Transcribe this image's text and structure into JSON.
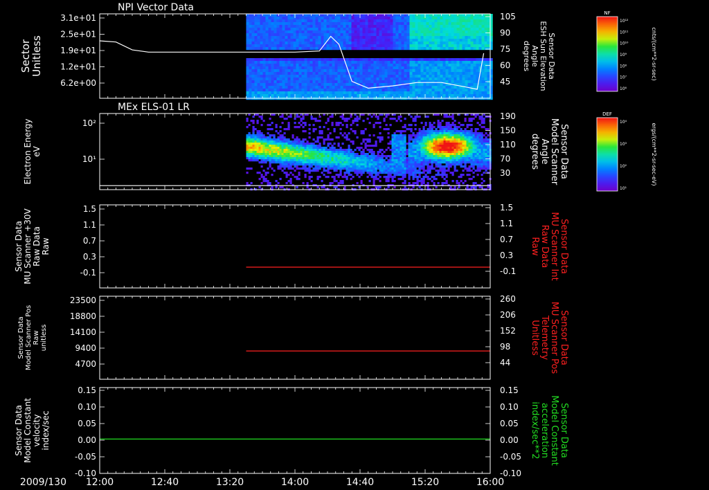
{
  "colors": {
    "axis": "#ffffff",
    "line_red": "#ff2020",
    "line_green": "#22dd22",
    "label_red": "#ff2020",
    "label_green": "#22dd22"
  },
  "colorbars": [
    {
      "label": "NF",
      "ticks": [
        "10¹²",
        "10¹¹",
        "10¹⁰",
        "10⁹",
        "10⁸",
        "10⁷",
        "10⁶"
      ],
      "units": "cnts/(cm**2-sr-sec)"
    },
    {
      "label": "DEF",
      "ticks": [
        "10⁴",
        "10³",
        "10²",
        "10¹"
      ],
      "units": "ergs/(cm**2-sr-sec-eV)"
    }
  ],
  "chart_data": [
    {
      "type": "heatmap",
      "title": "NPI Vector Data",
      "ylabel": [
        "Sector",
        "Unitless"
      ],
      "yticks": [
        "3.1e+01",
        "2.5e+01",
        "1.9e+01",
        "1.2e+01",
        "6.2e+00"
      ],
      "y2label": [
        "Sensor Data",
        "ESH Sun Elevation",
        "Angle",
        "degrees"
      ],
      "y2ticks": [
        "105",
        "90",
        "75",
        "60",
        "45"
      ],
      "y2lim": [
        30,
        105
      ],
      "data_start": "13:30",
      "overlay_series": {
        "name": "ESH Sun Elevation Angle",
        "x": [
          "12:00",
          "12:10",
          "12:20",
          "12:30",
          "13:00",
          "13:30",
          "14:00",
          "14:15",
          "14:22",
          "14:27",
          "14:35",
          "14:45",
          "15:00",
          "15:15",
          "15:30",
          "15:45",
          "15:52",
          "15:56"
        ],
        "y": [
          81,
          80,
          73,
          71,
          71,
          71,
          71,
          72,
          85,
          78,
          45,
          39,
          41,
          44,
          44,
          40,
          38,
          70
        ]
      }
    },
    {
      "type": "heatmap",
      "title": "MEx ELS-01 LR",
      "ylabel": [
        "Electron Energy",
        "eV"
      ],
      "yticks": [
        "10²",
        "10¹"
      ],
      "y2label": [
        "Sensor Data",
        "Model Scanner",
        "Angle",
        "degrees"
      ],
      "y2ticks": [
        "190",
        "150",
        "110",
        "70",
        "30"
      ],
      "y2lim": [
        0,
        190
      ],
      "data_start": "13:30",
      "overlay_series": {
        "name": "Model Scanner Angle",
        "x": [
          "12:00",
          "16:00"
        ],
        "y": [
          10,
          10
        ]
      }
    },
    {
      "type": "line",
      "ylabel": [
        "Sensor Data",
        "MU Scanner +30V",
        "Raw Data",
        "Raw"
      ],
      "yticks": [
        "1.5",
        "1.1",
        "0.7",
        "0.3",
        "-0.1"
      ],
      "ylim": [
        -0.5,
        1.5
      ],
      "y2label": [
        "Sensor Data",
        "MU Scanner Int",
        "Raw Data",
        "Raw"
      ],
      "y2ticks": [
        "1.5",
        "1.1",
        "0.7",
        "0.3",
        "-0.1"
      ],
      "series": [
        {
          "x": [
            "13:30",
            "16:00"
          ],
          "y": [
            0.0,
            0.0
          ],
          "color": "#ff2020"
        }
      ]
    },
    {
      "type": "line",
      "ylabel": [
        "Sensor Data",
        "Model Scanner Pos",
        "Raw",
        "unitless"
      ],
      "yticks": [
        "23500",
        "18800",
        "14100",
        "9400",
        "4700"
      ],
      "ylim": [
        0,
        23500
      ],
      "y2label": [
        "Sensor Data",
        "MU Scanner Pos",
        "Telemetry",
        "Unitless"
      ],
      "y2ticks": [
        "260",
        "206",
        "152",
        "98",
        "44"
      ],
      "y2lim": [
        -10,
        260
      ],
      "series": [
        {
          "x": [
            "13:30",
            "16:00"
          ],
          "y": [
            8000,
            8000
          ],
          "color": "#ff2020"
        }
      ]
    },
    {
      "type": "line",
      "ylabel": [
        "Sensor Data",
        "Model Constant",
        "velocity",
        "index/sec"
      ],
      "yticks": [
        "0.15",
        "0.10",
        "0.05",
        "0.00",
        "-0.05",
        "-0.10"
      ],
      "ylim": [
        -0.1,
        0.15
      ],
      "y2label": [
        "Sensor Data",
        "Model Constant",
        "acceleration",
        "index/sec**2"
      ],
      "y2ticks": [
        "0.15",
        "0.10",
        "0.05",
        "0.00",
        "-0.05",
        "-0.10"
      ],
      "series": [
        {
          "x": [
            "12:00",
            "16:00"
          ],
          "y": [
            0.0,
            0.0
          ],
          "color": "#22dd22"
        }
      ]
    }
  ],
  "xaxis": {
    "date": "2009/130",
    "range": [
      "12:00",
      "16:00"
    ],
    "ticks": [
      "12:00",
      "12:40",
      "13:20",
      "14:00",
      "14:40",
      "15:20",
      "16:00"
    ]
  }
}
